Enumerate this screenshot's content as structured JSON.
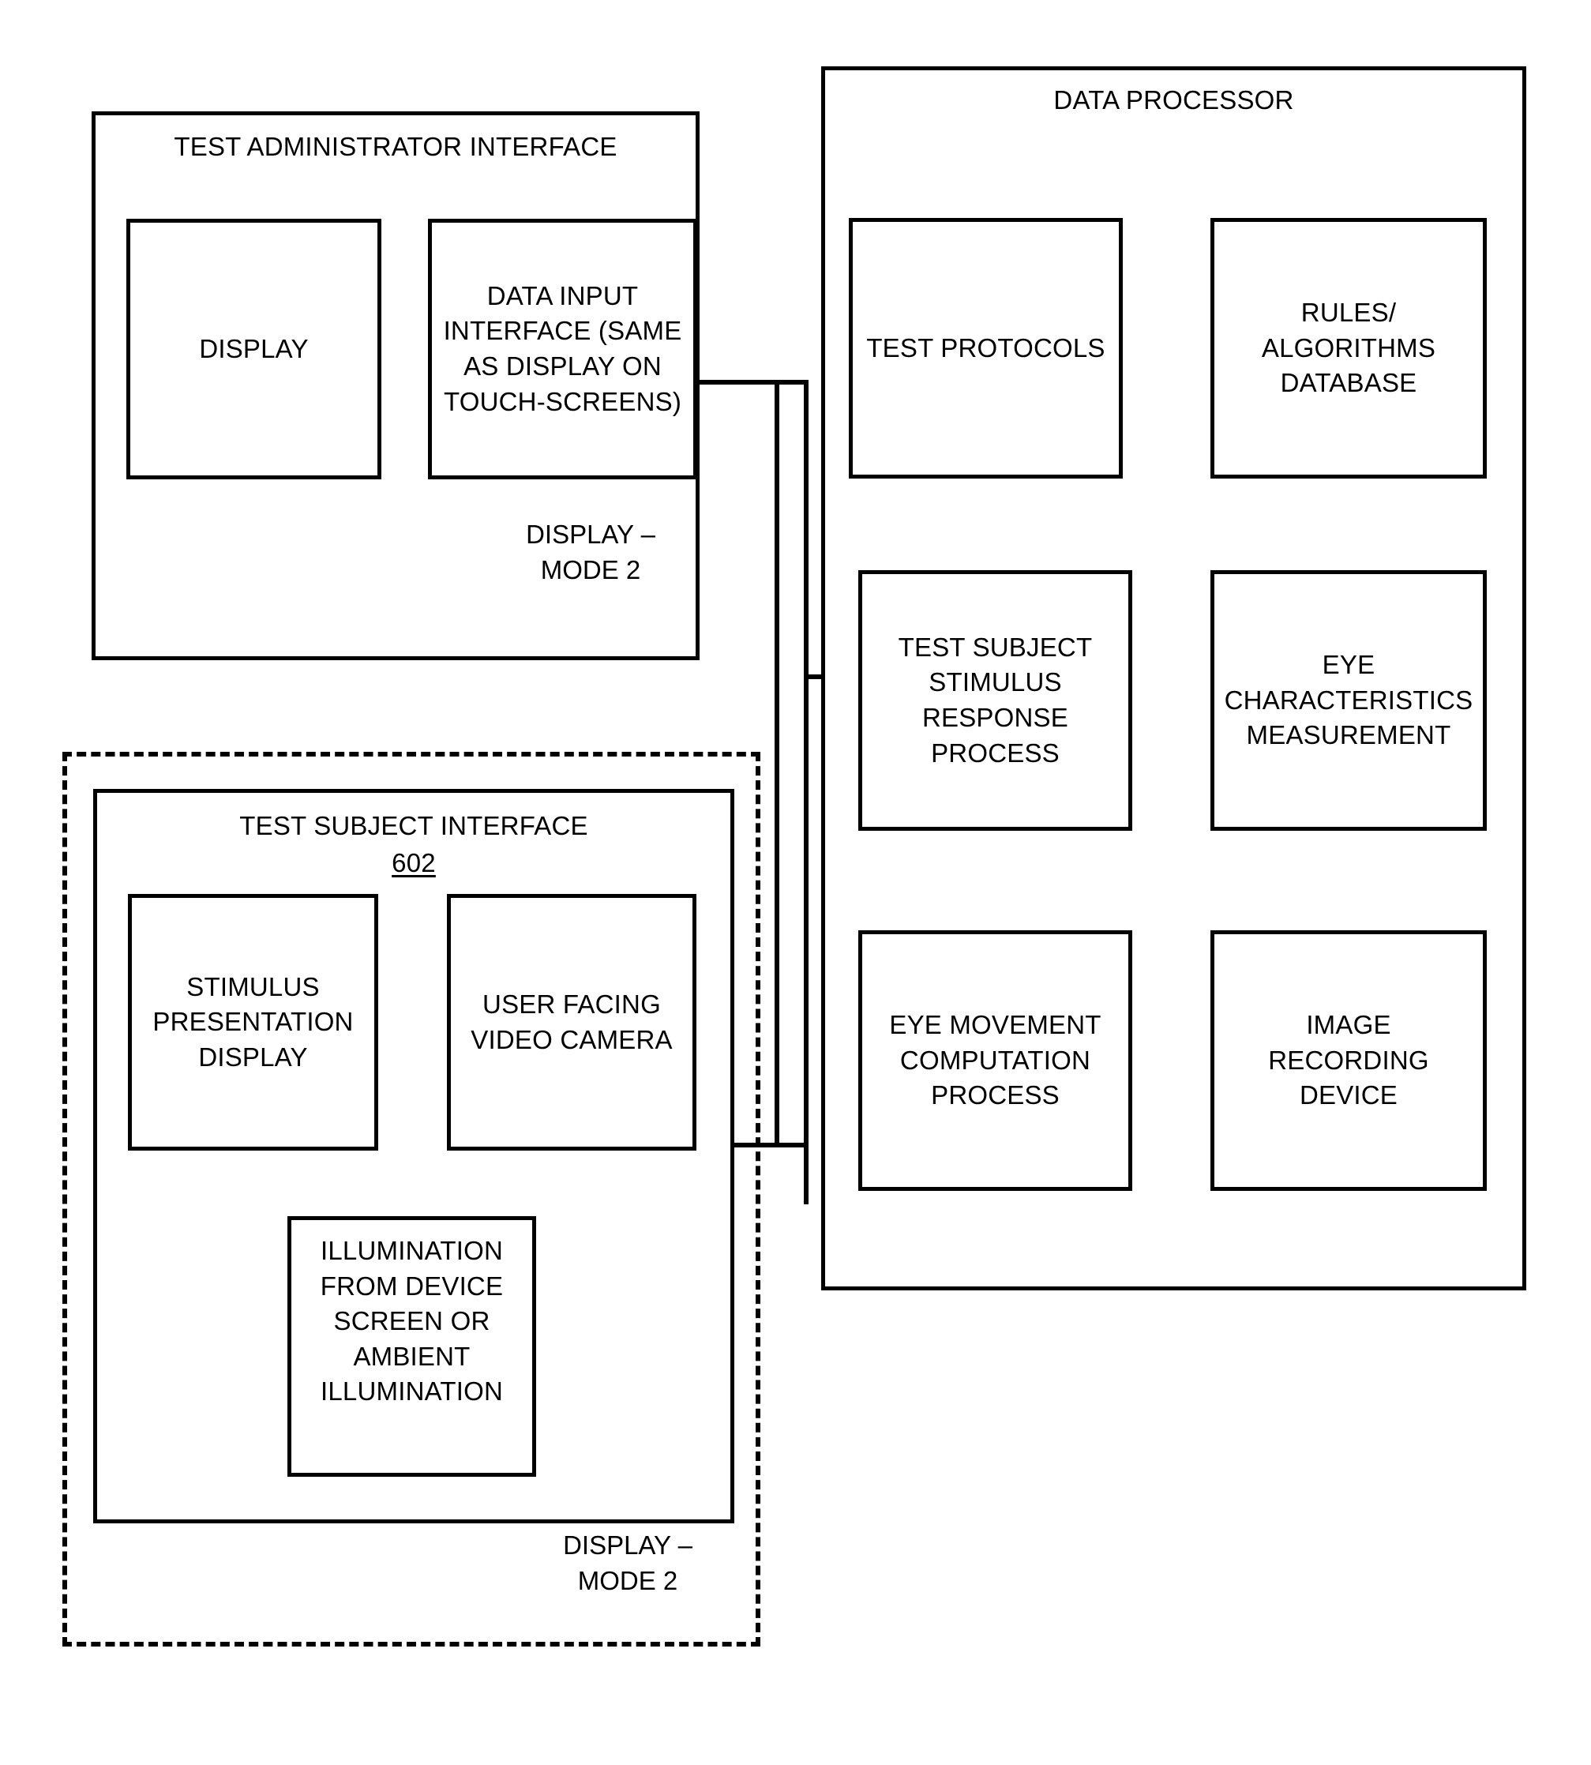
{
  "diagram": {
    "figure_reference": "602",
    "groups": {
      "test_administrator_interface": {
        "title": "TEST ADMINISTRATOR INTERFACE",
        "corner_label": "DISPLAY –\nMODE 2",
        "children": [
          {
            "label": "DISPLAY"
          },
          {
            "label": "DATA INPUT\nINTERFACE (SAME\nAS DISPLAY ON\nTOUCH-SCREENS)"
          }
        ]
      },
      "test_subject_interface": {
        "title": "TEST SUBJECT INTERFACE",
        "reference": "602",
        "corner_label": "DISPLAY –\nMODE 2",
        "children": [
          {
            "label": "STIMULUS\nPRESENTATION\nDISPLAY"
          },
          {
            "label": "USER FACING\nVIDEO CAMERA"
          },
          {
            "label": "ILLUMINATION\nFROM DEVICE\nSCREEN OR\nAMBIENT\nILLUMINATION"
          }
        ]
      },
      "data_processor": {
        "title": "DATA PROCESSOR",
        "children": [
          {
            "label": "TEST  PROTOCOLS"
          },
          {
            "label": "RULES/\nALGORITHMS\nDATABASE"
          },
          {
            "label": "TEST SUBJECT\nSTIMULUS\nRESPONSE\nPROCESS"
          },
          {
            "label": "EYE\nCHARACTERISTICS\nMEASUREMENT"
          },
          {
            "label": "EYE MOVEMENT\nCOMPUTATION\nPROCESS"
          },
          {
            "label": "IMAGE\nRECORDING\nDEVICE"
          }
        ]
      }
    },
    "colors": {
      "stroke": "#000000",
      "background": "#ffffff"
    }
  }
}
